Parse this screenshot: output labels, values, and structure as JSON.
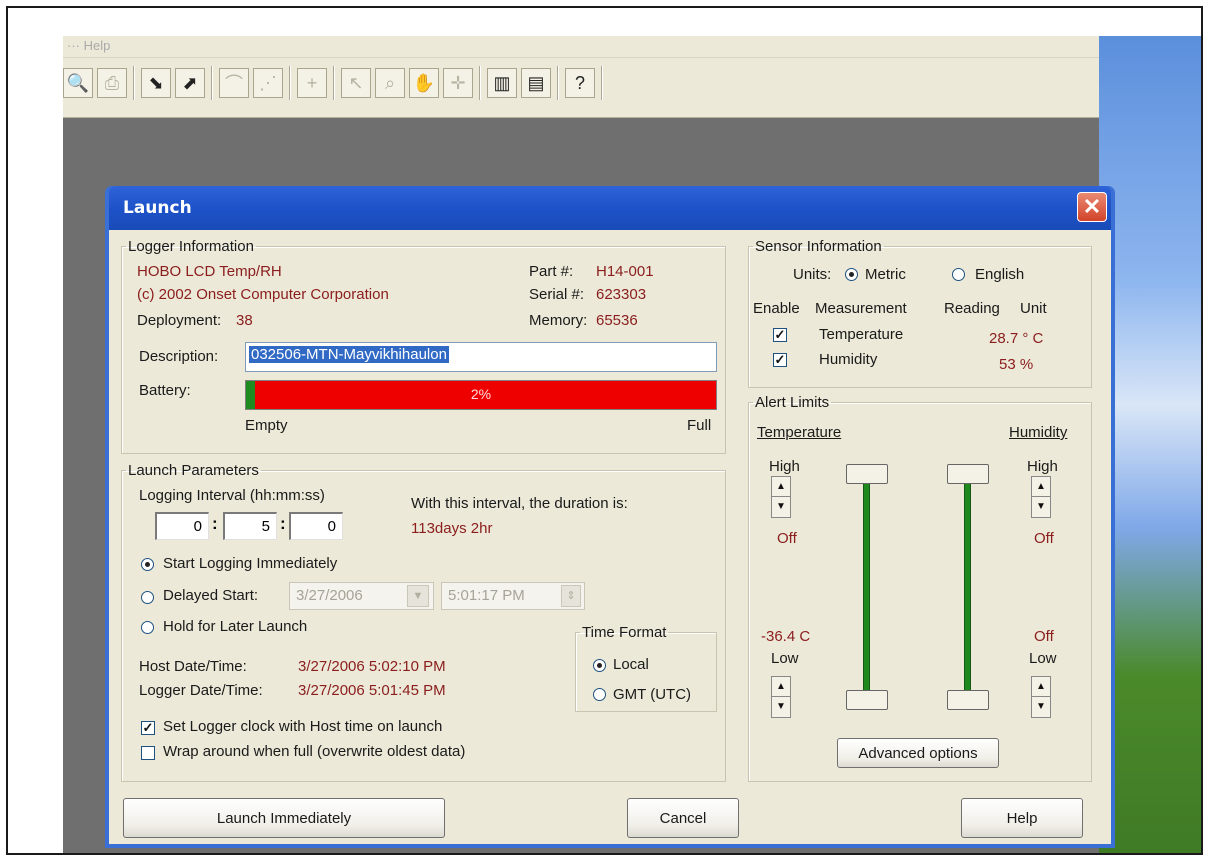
{
  "dialog": {
    "title": "Launch",
    "close_glyph": "✕"
  },
  "logger_info": {
    "legend": "Logger Information",
    "device_name": "HOBO LCD Temp/RH",
    "copyright": "(c) 2002 Onset Computer Corporation",
    "deployment_label": "Deployment:",
    "deployment_value": "38",
    "part_label": "Part #:",
    "part_value": "H14-001",
    "serial_label": "Serial #:",
    "serial_value": "623303",
    "memory_label": "Memory:",
    "memory_value": "65536",
    "description_label": "Description:",
    "description_value": "032506-MTN-Mayvikhihaulon",
    "battery_label": "Battery:",
    "battery_percent_text": "2%",
    "battery_level": 0.02,
    "battery_empty": "Empty",
    "battery_full": "Full"
  },
  "launch_params": {
    "legend": "Launch Parameters",
    "interval_label": "Logging Interval (hh:mm:ss)",
    "interval_hh": "0",
    "interval_mm": "5",
    "interval_ss": "0",
    "duration_label": "With this interval, the duration is:",
    "duration_value": "113days 2hr",
    "start_immediately": "Start Logging Immediately",
    "delayed_start": "Delayed Start:",
    "delayed_date": "3/27/2006",
    "delayed_time": "5:01:17 PM",
    "hold_later": "Hold for Later Launch",
    "host_dt_label": "Host Date/Time:",
    "host_dt_value": "3/27/2006 5:02:10 PM",
    "logger_dt_label": "Logger Date/Time:",
    "logger_dt_value": "3/27/2006 5:01:45 PM",
    "set_clock": "Set Logger clock with Host time on launch",
    "wrap_around": "Wrap around when full (overwrite oldest data)",
    "time_format_legend": "Time Format",
    "local": "Local",
    "gmt": "GMT (UTC)"
  },
  "sensor_info": {
    "legend": "Sensor Information",
    "units_label": "Units:",
    "metric": "Metric",
    "english": "English",
    "col_enable": "Enable",
    "col_measurement": "Measurement",
    "col_reading": "Reading",
    "col_unit": "Unit",
    "temperature_label": "Temperature",
    "temperature_reading": "28.7 ° C",
    "humidity_label": "Humidity",
    "humidity_reading": "53 %"
  },
  "alert_limits": {
    "legend": "Alert Limits",
    "temp_header": "Temperature",
    "hum_header": "Humidity",
    "high": "High",
    "low": "Low",
    "temp_high_value": "Off",
    "hum_high_value": "Off",
    "temp_low_value": "-36.4 C",
    "hum_low_value": "Off",
    "advanced": "Advanced options"
  },
  "buttons": {
    "launch": "Launch Immediately",
    "cancel": "Cancel",
    "help": "Help"
  },
  "toolbar": {
    "menu_text": "··· Help"
  }
}
